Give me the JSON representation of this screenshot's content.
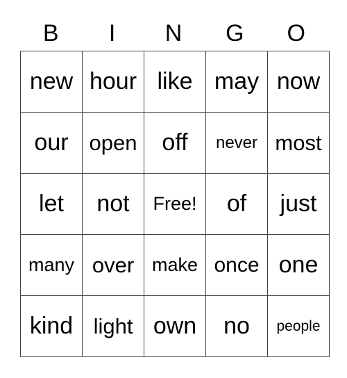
{
  "header": [
    "B",
    "I",
    "N",
    "G",
    "O"
  ],
  "rows": [
    [
      "new",
      "hour",
      "like",
      "may",
      "now"
    ],
    [
      "our",
      "open",
      "off",
      "never",
      "most"
    ],
    [
      "let",
      "not",
      "Free!",
      "of",
      "just"
    ],
    [
      "many",
      "over",
      "make",
      "once",
      "one"
    ],
    [
      "kind",
      "light",
      "own",
      "no",
      "people"
    ]
  ]
}
